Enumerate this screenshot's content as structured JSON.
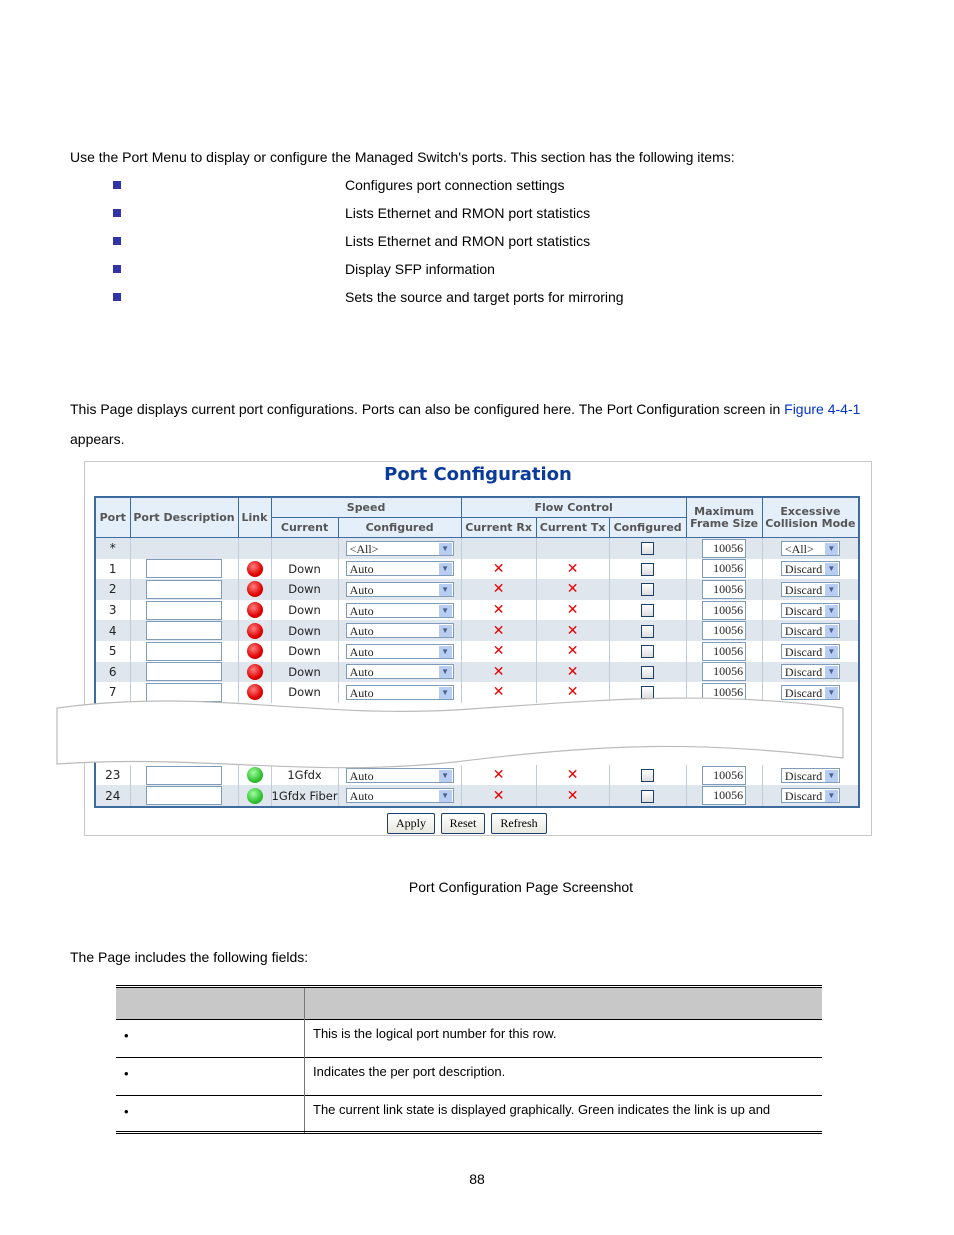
{
  "intro": "Use the Port Menu to display or configure the Managed Switch's ports. This section has the following items:",
  "items": [
    {
      "label": "",
      "desc": "Configures port connection settings"
    },
    {
      "label": "",
      "desc": "Lists Ethernet and RMON port statistics"
    },
    {
      "label": "",
      "desc": "Lists Ethernet and RMON port statistics"
    },
    {
      "label": "",
      "desc": "Display SFP information"
    },
    {
      "label": "",
      "desc": "Sets the source and target ports for mirroring"
    }
  ],
  "para1": "This Page displays current port configurations. Ports can also be configured here. The Port Configuration screen in ",
  "para1_link": "Figure 4-4-1",
  "para1_end": "appears.",
  "screen": {
    "title": "Port Configuration",
    "headers": {
      "port": "Port",
      "desc": "Port Description",
      "link": "Link",
      "speed": "Speed",
      "current": "Current",
      "configured": "Configured",
      "flow": "Flow Control",
      "rx": "Current Rx",
      "tx": "Current Tx",
      "fconf": "Configured",
      "max1": "Maximum",
      "max2": "Frame Size",
      "exc1": "Excessive",
      "exc2": "Collision Mode"
    },
    "all_row": {
      "port": "*",
      "speed": "<All>",
      "frame": "10056",
      "collision": "<All>"
    },
    "rows": [
      {
        "port": "1",
        "link": "red",
        "current": "Down",
        "speed": "Auto",
        "frame": "10056",
        "collision": "Discard"
      },
      {
        "port": "2",
        "link": "red",
        "current": "Down",
        "speed": "Auto",
        "frame": "10056",
        "collision": "Discard"
      },
      {
        "port": "3",
        "link": "red",
        "current": "Down",
        "speed": "Auto",
        "frame": "10056",
        "collision": "Discard"
      },
      {
        "port": "4",
        "link": "red",
        "current": "Down",
        "speed": "Auto",
        "frame": "10056",
        "collision": "Discard"
      },
      {
        "port": "5",
        "link": "red",
        "current": "Down",
        "speed": "Auto",
        "frame": "10056",
        "collision": "Discard"
      },
      {
        "port": "6",
        "link": "red",
        "current": "Down",
        "speed": "Auto",
        "frame": "10056",
        "collision": "Discard"
      },
      {
        "port": "7",
        "link": "red",
        "current": "Down",
        "speed": "Auto",
        "frame": "10056",
        "collision": "Discard"
      },
      {
        "port": "23",
        "link": "green",
        "current": "1Gfdx",
        "speed": "Auto",
        "frame": "10056",
        "collision": "Discard"
      },
      {
        "port": "24",
        "link": "green",
        "current": "1Gfdx Fiber",
        "speed": "Auto",
        "frame": "10056",
        "collision": "Discard"
      }
    ],
    "buttons": {
      "apply": "Apply",
      "reset": "Reset",
      "refresh": "Refresh"
    },
    "colors": {
      "link_down": "#e00000",
      "link_up": "#30c030",
      "header_bg": "#e4effa",
      "border": "#3d6b9e"
    }
  },
  "caption": "Port Configuration Page Screenshot",
  "fields_intro": "The Page includes the following fields:",
  "fields_header": [
    "",
    ""
  ],
  "fields": [
    {
      "object": "",
      "desc": "This is the logical port number for this row."
    },
    {
      "object": "",
      "desc": "Indicates the per port description."
    },
    {
      "object": "",
      "desc": "The current link state is displayed graphically. Green indicates the link is up and"
    }
  ],
  "page_number": "88"
}
